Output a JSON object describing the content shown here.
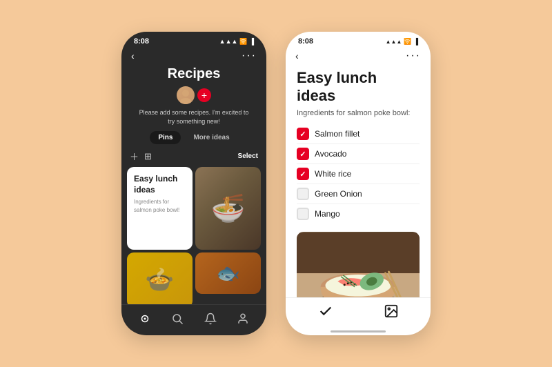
{
  "left_phone": {
    "status_time": "8:08",
    "title": "Recipes",
    "subtitle": "Please add some recipes. I'm excited to try something new!",
    "tabs": [
      "Pins",
      "More ideas"
    ],
    "active_tab": "Pins",
    "select_label": "Select",
    "pin_card": {
      "title": "Easy lunch ideas",
      "subtitle": "Ingredients for salmon poke bowl!"
    },
    "nav_items": [
      "home",
      "search",
      "bell",
      "user"
    ]
  },
  "right_phone": {
    "status_time": "8:08",
    "title": "Easy lunch ideas",
    "subtitle": "Ingredients for salmon poke bowl:",
    "ingredients": [
      {
        "name": "Salmon fillet",
        "checked": true
      },
      {
        "name": "Avocado",
        "checked": true
      },
      {
        "name": "White rice",
        "checked": true
      },
      {
        "name": "Green Onion",
        "checked": false
      },
      {
        "name": "Mango",
        "checked": false
      }
    ]
  }
}
